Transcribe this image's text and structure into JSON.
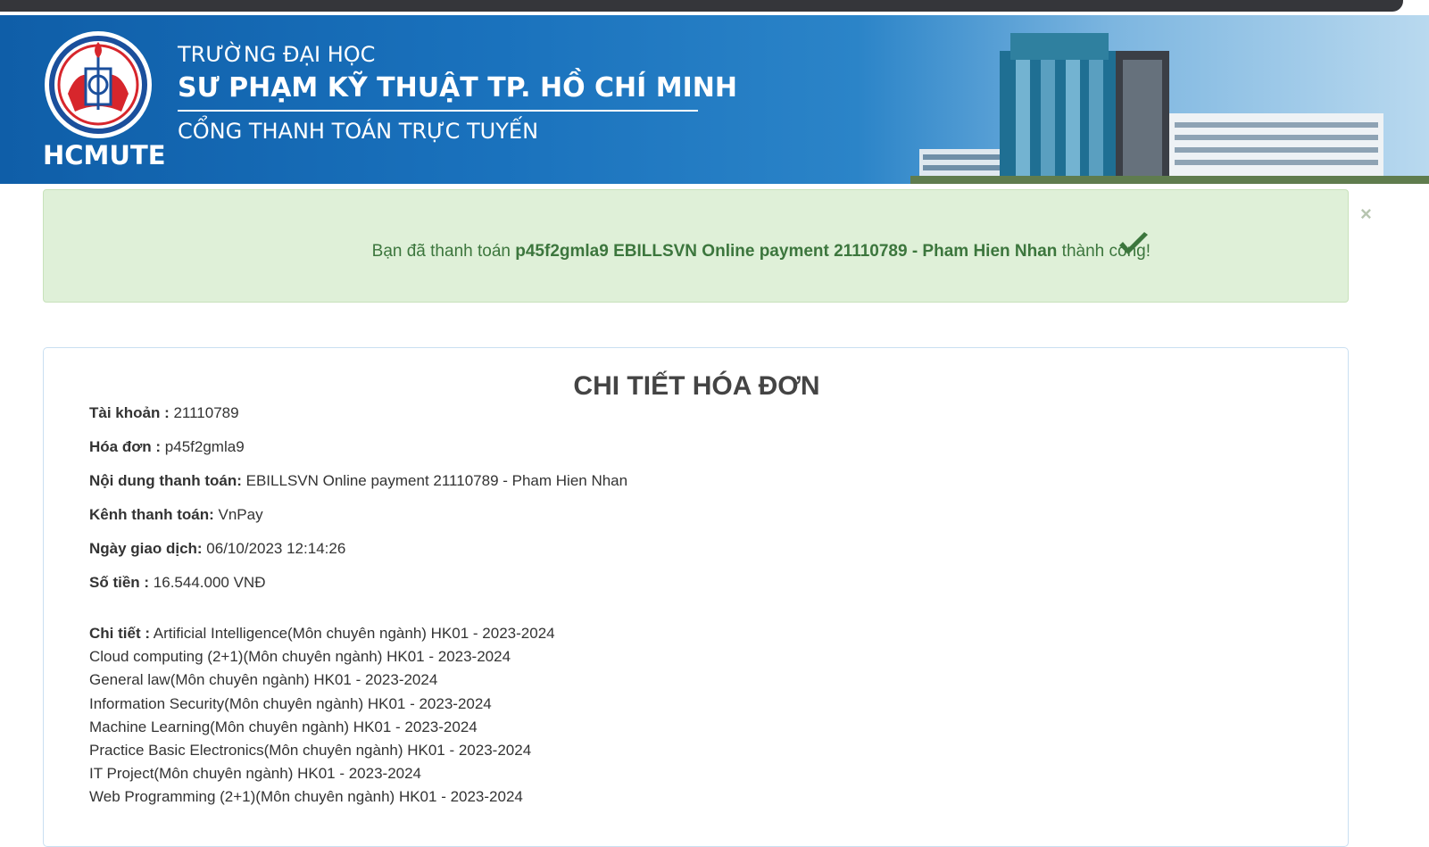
{
  "header": {
    "logo_text": "HCMUTE",
    "university_line1": "TRƯỜNG ĐẠI HỌC",
    "university_line2": "SƯ PHẠM KỸ THUẬT TP. HỒ CHÍ MINH",
    "portal_name": "CỔNG THANH TOÁN TRỰC TUYẾN"
  },
  "alert": {
    "prefix": "Bạn đã thanh toán ",
    "highlight": "p45f2gmla9 EBILLSVN Online payment 21110789 - Pham Hien Nhan",
    "suffix": " thành công!",
    "close_symbol": "×",
    "icon": "check-icon",
    "color": "#3c763d"
  },
  "invoice": {
    "title": "CHI TIẾT HÓA ĐƠN",
    "fields": [
      {
        "label": "Tài khoản :",
        "value": " 21110789"
      },
      {
        "label": "Hóa đơn :",
        "value": " p45f2gmla9"
      },
      {
        "label": "Nội dung thanh toán:",
        "value": " EBILLSVN Online payment 21110789 - Pham Hien Nhan"
      },
      {
        "label": "Kênh thanh toán:",
        "value": " VnPay"
      },
      {
        "label": "Ngày giao dịch:",
        "value": " 06/10/2023 12:14:26"
      },
      {
        "label": "Số tiền :",
        "value": " 16.544.000 VNĐ"
      }
    ],
    "details_label": "Chi tiết :",
    "details": [
      " Artificial Intelligence(Môn chuyên ngành) HK01 - 2023-2024",
      "Cloud computing (2+1)(Môn chuyên ngành) HK01 - 2023-2024",
      "General law(Môn chuyên ngành) HK01 - 2023-2024",
      "Information Security(Môn chuyên ngành) HK01 - 2023-2024",
      "Machine Learning(Môn chuyên ngành) HK01 - 2023-2024",
      "Practice Basic Electronics(Môn chuyên ngành) HK01 - 2023-2024",
      "IT Project(Môn chuyên ngành) HK01 - 2023-2024",
      "Web Programming (2+1)(Môn chuyên ngành) HK01 - 2023-2024"
    ]
  }
}
